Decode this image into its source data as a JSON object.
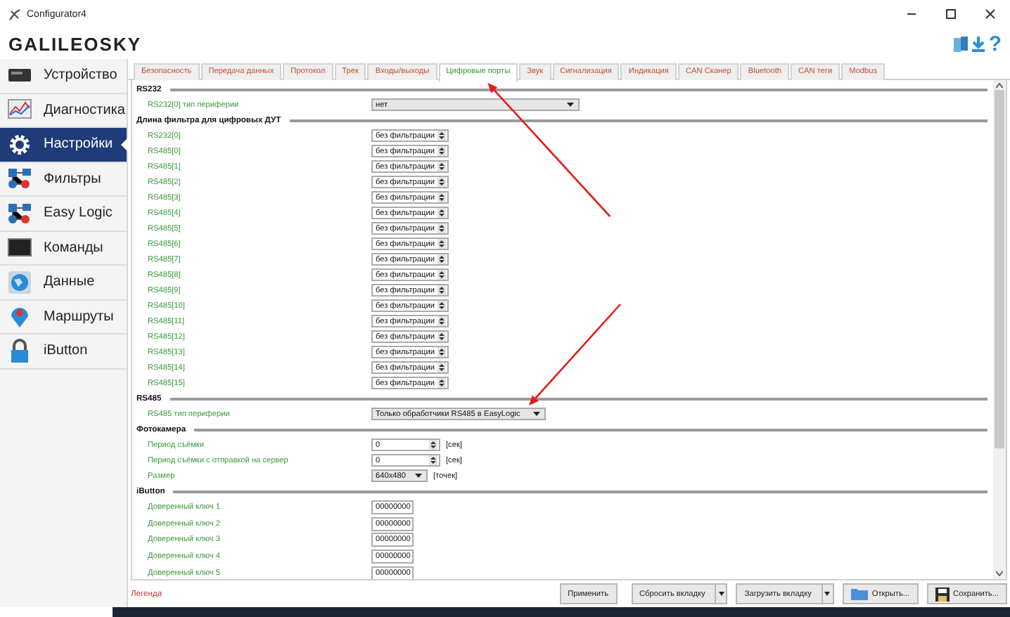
{
  "window": {
    "title": "Configurator4"
  },
  "header": {
    "logo": "GALILEOSKY",
    "help": "?"
  },
  "sidebar": {
    "items": [
      {
        "label": "Устройство",
        "kind": "device",
        "selected": false
      },
      {
        "label": "Диагностика",
        "kind": "chart",
        "selected": false
      },
      {
        "label": "Настройки",
        "kind": "gear",
        "selected": true
      },
      {
        "label": "Фильтры",
        "kind": "nodes",
        "selected": false
      },
      {
        "label": "Easy Logic",
        "kind": "nodes",
        "selected": false
      },
      {
        "label": "Команды",
        "kind": "monitor",
        "selected": false
      },
      {
        "label": "Данные",
        "kind": "globe",
        "selected": false
      },
      {
        "label": "Маршруты",
        "kind": "pin",
        "selected": false
      },
      {
        "label": "iButton",
        "kind": "lock",
        "selected": false
      }
    ]
  },
  "tabs": [
    {
      "label": "Безопасность",
      "selected": false
    },
    {
      "label": "Передача данных",
      "selected": false
    },
    {
      "label": "Протокол",
      "selected": false
    },
    {
      "label": "Трек",
      "selected": false
    },
    {
      "label": "Входы/выходы",
      "selected": false
    },
    {
      "label": "Цифровые порты",
      "selected": true
    },
    {
      "label": "Звук",
      "selected": false
    },
    {
      "label": "Сигнализация",
      "selected": false
    },
    {
      "label": "Индикация",
      "selected": false
    },
    {
      "label": "CAN Сканер",
      "selected": false
    },
    {
      "label": "Bluetooth",
      "selected": false
    },
    {
      "label": "CAN теги",
      "selected": false
    },
    {
      "label": "Modbus",
      "selected": false
    }
  ],
  "sections": [
    {
      "title": "RS232",
      "rows": [
        {
          "kind": "select",
          "label": "RS232[0] тип периферии",
          "value": "нет"
        }
      ]
    },
    {
      "title": "Длина фильтра для цифровых ДУТ",
      "rows": [
        {
          "kind": "spin",
          "label": "RS232[0]",
          "value": "без фильтрации"
        },
        {
          "kind": "spin",
          "label": "RS485[0]",
          "value": "без фильтрации"
        },
        {
          "kind": "spin",
          "label": "RS485[1]",
          "value": "без фильтрации"
        },
        {
          "kind": "spin",
          "label": "RS485[2]",
          "value": "без фильтрации"
        },
        {
          "kind": "spin",
          "label": "RS485[3]",
          "value": "без фильтрации"
        },
        {
          "kind": "spin",
          "label": "RS485[4]",
          "value": "без фильтрации"
        },
        {
          "kind": "spin",
          "label": "RS485[5]",
          "value": "без фильтрации"
        },
        {
          "kind": "spin",
          "label": "RS485[6]",
          "value": "без фильтрации"
        },
        {
          "kind": "spin",
          "label": "RS485[7]",
          "value": "без фильтрации"
        },
        {
          "kind": "spin",
          "label": "RS485[8]",
          "value": "без фильтрации"
        },
        {
          "kind": "spin",
          "label": "RS485[9]",
          "value": "без фильтрации"
        },
        {
          "kind": "spin",
          "label": "RS485[10]",
          "value": "без фильтрации"
        },
        {
          "kind": "spin",
          "label": "RS485[11]",
          "value": "без фильтрации"
        },
        {
          "kind": "spin",
          "label": "RS485[12]",
          "value": "без фильтрации"
        },
        {
          "kind": "spin",
          "label": "RS485[13]",
          "value": "без фильтрации"
        },
        {
          "kind": "spin",
          "label": "RS485[14]",
          "value": "без фильтрации"
        },
        {
          "kind": "spin",
          "label": "RS485[15]",
          "value": "без фильтрации"
        }
      ]
    },
    {
      "title": "RS485",
      "rows": [
        {
          "kind": "select",
          "label": "RS485 тип периферии",
          "value": "Только обработчики RS485 в EasyLogic"
        }
      ]
    },
    {
      "title": "Фотокамера",
      "rows": [
        {
          "kind": "spin",
          "label": "Период съёмки",
          "value": "0",
          "unit": "[сек]"
        },
        {
          "kind": "spin",
          "label": "Период съёмки с отправкой на сервер",
          "value": "0",
          "unit": "[сек]"
        },
        {
          "kind": "select",
          "label": "Размер",
          "value": "640x480",
          "unit": "[точек]"
        }
      ]
    },
    {
      "title": "iButton",
      "rows": [
        {
          "kind": "text",
          "label": "Доверенный ключ 1",
          "value": "00000000"
        },
        {
          "kind": "text",
          "label": "Доверенный ключ 2",
          "value": "00000000"
        },
        {
          "kind": "text",
          "label": "Доверенный ключ 3",
          "value": "00000000"
        },
        {
          "kind": "text",
          "label": "Доверенный ключ 4",
          "value": "00000000"
        },
        {
          "kind": "text",
          "label": "Доверенный ключ 5",
          "value": "00000000"
        }
      ]
    }
  ],
  "legend": "Легенда",
  "buttons": [
    {
      "label": "Применить",
      "kind": "plain"
    },
    {
      "label": "Сбросить вкладку",
      "kind": "split"
    },
    {
      "label": "Загрузить вкладку",
      "kind": "split"
    },
    {
      "label": "Открыть...",
      "kind": "open"
    },
    {
      "label": "Сохранить...",
      "kind": "save"
    }
  ],
  "annotations": [
    {
      "kind": "arrow"
    },
    {
      "kind": "arrow"
    }
  ]
}
